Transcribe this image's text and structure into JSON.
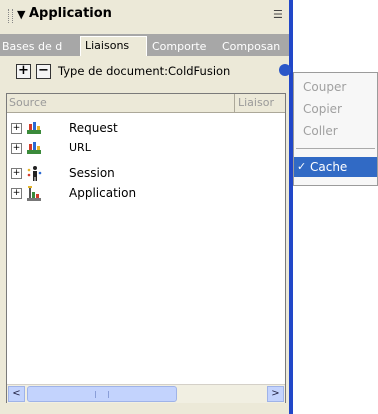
{
  "panel": {
    "title": "Application",
    "title_arrow": "▼",
    "menu_icon": "☰"
  },
  "tabs": [
    "Bases de d",
    "Liaisons",
    "Comporte",
    "Composan"
  ],
  "active_tab_index": 1,
  "toolbar": {
    "add_label": "+",
    "remove_label": "−",
    "doc_type": "Type de document:ColdFusion"
  },
  "list": {
    "col_source": "Source",
    "col_liaison": "Liaisor",
    "items": [
      {
        "label": "Request",
        "icon": "request-icon"
      },
      {
        "label": "URL",
        "icon": "url-icon"
      },
      {
        "label": "Session",
        "icon": "session-icon"
      },
      {
        "label": "Application",
        "icon": "application-icon"
      }
    ]
  },
  "scrollbar": {
    "left_arrow": "<",
    "right_arrow": ">"
  },
  "context_menu": {
    "items": [
      {
        "label": "Couper",
        "enabled": false
      },
      {
        "label": "Copier",
        "enabled": false
      },
      {
        "label": "Coller",
        "enabled": false
      },
      {
        "label": "Cache",
        "enabled": true,
        "checked": true,
        "selected": true
      }
    ],
    "check_glyph": "✓"
  },
  "colors": {
    "panel_bg": "#ece9d8",
    "tab_bar": "#a7a7a7",
    "selection": "#316ac5",
    "border_blue": "#2147c8"
  }
}
